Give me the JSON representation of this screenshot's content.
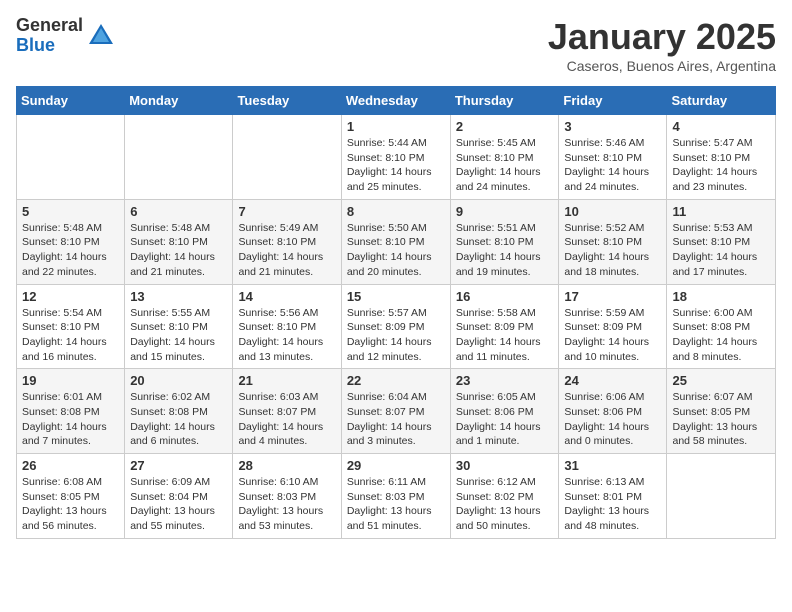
{
  "logo": {
    "general": "General",
    "blue": "Blue"
  },
  "header": {
    "month": "January 2025",
    "location": "Caseros, Buenos Aires, Argentina"
  },
  "days_of_week": [
    "Sunday",
    "Monday",
    "Tuesday",
    "Wednesday",
    "Thursday",
    "Friday",
    "Saturday"
  ],
  "weeks": [
    [
      {
        "day": "",
        "info": ""
      },
      {
        "day": "",
        "info": ""
      },
      {
        "day": "",
        "info": ""
      },
      {
        "day": "1",
        "info": "Sunrise: 5:44 AM\nSunset: 8:10 PM\nDaylight: 14 hours and 25 minutes."
      },
      {
        "day": "2",
        "info": "Sunrise: 5:45 AM\nSunset: 8:10 PM\nDaylight: 14 hours and 24 minutes."
      },
      {
        "day": "3",
        "info": "Sunrise: 5:46 AM\nSunset: 8:10 PM\nDaylight: 14 hours and 24 minutes."
      },
      {
        "day": "4",
        "info": "Sunrise: 5:47 AM\nSunset: 8:10 PM\nDaylight: 14 hours and 23 minutes."
      }
    ],
    [
      {
        "day": "5",
        "info": "Sunrise: 5:48 AM\nSunset: 8:10 PM\nDaylight: 14 hours and 22 minutes."
      },
      {
        "day": "6",
        "info": "Sunrise: 5:48 AM\nSunset: 8:10 PM\nDaylight: 14 hours and 21 minutes."
      },
      {
        "day": "7",
        "info": "Sunrise: 5:49 AM\nSunset: 8:10 PM\nDaylight: 14 hours and 21 minutes."
      },
      {
        "day": "8",
        "info": "Sunrise: 5:50 AM\nSunset: 8:10 PM\nDaylight: 14 hours and 20 minutes."
      },
      {
        "day": "9",
        "info": "Sunrise: 5:51 AM\nSunset: 8:10 PM\nDaylight: 14 hours and 19 minutes."
      },
      {
        "day": "10",
        "info": "Sunrise: 5:52 AM\nSunset: 8:10 PM\nDaylight: 14 hours and 18 minutes."
      },
      {
        "day": "11",
        "info": "Sunrise: 5:53 AM\nSunset: 8:10 PM\nDaylight: 14 hours and 17 minutes."
      }
    ],
    [
      {
        "day": "12",
        "info": "Sunrise: 5:54 AM\nSunset: 8:10 PM\nDaylight: 14 hours and 16 minutes."
      },
      {
        "day": "13",
        "info": "Sunrise: 5:55 AM\nSunset: 8:10 PM\nDaylight: 14 hours and 15 minutes."
      },
      {
        "day": "14",
        "info": "Sunrise: 5:56 AM\nSunset: 8:10 PM\nDaylight: 14 hours and 13 minutes."
      },
      {
        "day": "15",
        "info": "Sunrise: 5:57 AM\nSunset: 8:09 PM\nDaylight: 14 hours and 12 minutes."
      },
      {
        "day": "16",
        "info": "Sunrise: 5:58 AM\nSunset: 8:09 PM\nDaylight: 14 hours and 11 minutes."
      },
      {
        "day": "17",
        "info": "Sunrise: 5:59 AM\nSunset: 8:09 PM\nDaylight: 14 hours and 10 minutes."
      },
      {
        "day": "18",
        "info": "Sunrise: 6:00 AM\nSunset: 8:08 PM\nDaylight: 14 hours and 8 minutes."
      }
    ],
    [
      {
        "day": "19",
        "info": "Sunrise: 6:01 AM\nSunset: 8:08 PM\nDaylight: 14 hours and 7 minutes."
      },
      {
        "day": "20",
        "info": "Sunrise: 6:02 AM\nSunset: 8:08 PM\nDaylight: 14 hours and 6 minutes."
      },
      {
        "day": "21",
        "info": "Sunrise: 6:03 AM\nSunset: 8:07 PM\nDaylight: 14 hours and 4 minutes."
      },
      {
        "day": "22",
        "info": "Sunrise: 6:04 AM\nSunset: 8:07 PM\nDaylight: 14 hours and 3 minutes."
      },
      {
        "day": "23",
        "info": "Sunrise: 6:05 AM\nSunset: 8:06 PM\nDaylight: 14 hours and 1 minute."
      },
      {
        "day": "24",
        "info": "Sunrise: 6:06 AM\nSunset: 8:06 PM\nDaylight: 14 hours and 0 minutes."
      },
      {
        "day": "25",
        "info": "Sunrise: 6:07 AM\nSunset: 8:05 PM\nDaylight: 13 hours and 58 minutes."
      }
    ],
    [
      {
        "day": "26",
        "info": "Sunrise: 6:08 AM\nSunset: 8:05 PM\nDaylight: 13 hours and 56 minutes."
      },
      {
        "day": "27",
        "info": "Sunrise: 6:09 AM\nSunset: 8:04 PM\nDaylight: 13 hours and 55 minutes."
      },
      {
        "day": "28",
        "info": "Sunrise: 6:10 AM\nSunset: 8:03 PM\nDaylight: 13 hours and 53 minutes."
      },
      {
        "day": "29",
        "info": "Sunrise: 6:11 AM\nSunset: 8:03 PM\nDaylight: 13 hours and 51 minutes."
      },
      {
        "day": "30",
        "info": "Sunrise: 6:12 AM\nSunset: 8:02 PM\nDaylight: 13 hours and 50 minutes."
      },
      {
        "day": "31",
        "info": "Sunrise: 6:13 AM\nSunset: 8:01 PM\nDaylight: 13 hours and 48 minutes."
      },
      {
        "day": "",
        "info": ""
      }
    ]
  ]
}
